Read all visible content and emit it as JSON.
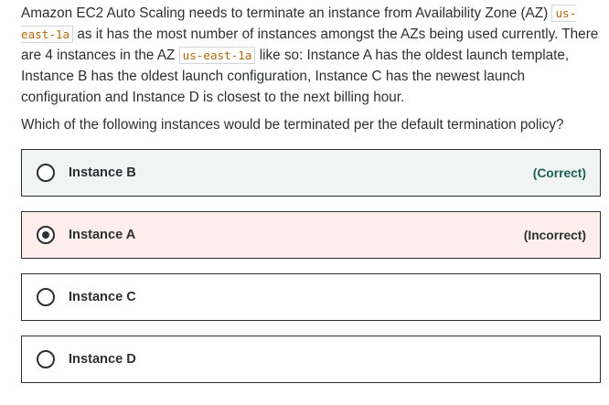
{
  "question": {
    "part1": "Amazon EC2 Auto Scaling needs to terminate an instance from Availability Zone (AZ) ",
    "code1": "us-east-1a",
    "part2": " as it has the most number of instances amongst the AZs being used currently. There are 4 instances in the AZ ",
    "code2": "us-east-1a",
    "part3": " like so: Instance A has the oldest launch template, Instance B has the oldest launch configuration, Instance C has the newest launch configuration and Instance D is closest to the next billing hour.",
    "prompt": "Which of the following instances would be terminated per the default termination policy?"
  },
  "options": [
    {
      "label": "Instance B",
      "status": "(Correct)",
      "state": "correct",
      "selected": false
    },
    {
      "label": "Instance A",
      "status": "(Incorrect)",
      "state": "incorrect",
      "selected": true
    },
    {
      "label": "Instance C",
      "status": "",
      "state": "neutral",
      "selected": false
    },
    {
      "label": "Instance D",
      "status": "",
      "state": "neutral",
      "selected": false
    }
  ],
  "colors": {
    "text": "#2d2f31",
    "code_text": "#b4690e",
    "correct_bg": "#f0f4f2",
    "correct_status": "#1e6055",
    "incorrect_bg": "#fdeeec",
    "border": "#2d2f31"
  },
  "icons": {
    "radio_unchecked": "radio-unchecked-icon",
    "radio_checked": "radio-checked-icon"
  }
}
